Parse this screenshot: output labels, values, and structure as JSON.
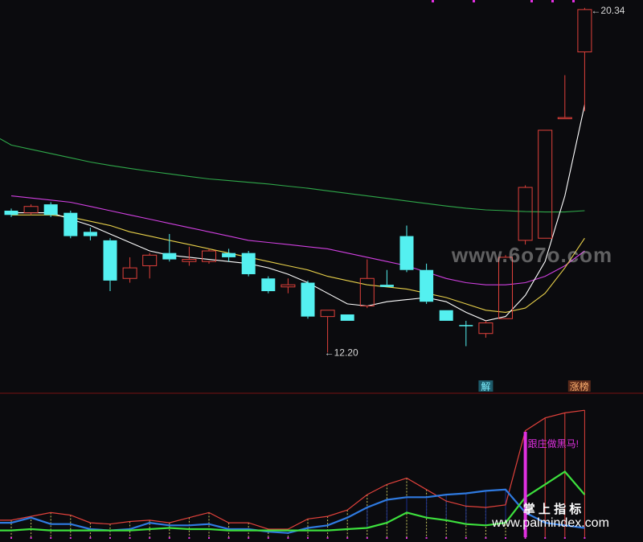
{
  "colors": {
    "background": "#0b0b0e",
    "up_candle": "#e0413b",
    "down_candle": "#54f0f0",
    "ma5": "#ffffff",
    "ma10": "#e8d04a",
    "ma20": "#d040e0",
    "ma60": "#2fa84a",
    "sub_red": "#e0413b",
    "sub_blue": "#2f7ae0",
    "sub_green": "#3de03d",
    "marker": "#e030e0",
    "divider": "#7a1212"
  },
  "labels": {
    "low_price": "12.20",
    "high_price": "20.34",
    "tag_jie": "解",
    "tag_zhangbang": "涨榜",
    "sub_signal": "跟庄做黑马!",
    "watermark_top": "www.6o7o.com",
    "watermark_brand": "掌 上 指 标",
    "watermark_url": "www.palmindex.com"
  },
  "chart_data": [
    {
      "type": "candlestick",
      "title": "",
      "ylim": [
        11.6,
        20.45
      ],
      "annotations": [
        {
          "text": "12.20",
          "at_index": 16,
          "value": 12.2
        },
        {
          "text": "20.34",
          "at_index": 29,
          "value": 20.34
        },
        {
          "text": "解",
          "at_index": 24
        },
        {
          "text": "涨榜",
          "at_index": 28
        }
      ],
      "candles": [
        {
          "o": 15.55,
          "c": 15.45,
          "h": 15.6,
          "l": 15.4
        },
        {
          "o": 15.5,
          "c": 15.65,
          "h": 15.7,
          "l": 15.45
        },
        {
          "o": 15.7,
          "c": 15.45,
          "h": 15.75,
          "l": 15.4
        },
        {
          "o": 15.5,
          "c": 14.95,
          "h": 15.55,
          "l": 14.9
        },
        {
          "o": 15.05,
          "c": 14.95,
          "h": 15.15,
          "l": 14.85
        },
        {
          "o": 14.85,
          "c": 13.9,
          "h": 14.9,
          "l": 13.65
        },
        {
          "o": 13.95,
          "c": 14.2,
          "h": 14.45,
          "l": 13.85
        },
        {
          "o": 14.25,
          "c": 14.5,
          "h": 14.55,
          "l": 13.95
        },
        {
          "o": 14.55,
          "c": 14.4,
          "h": 15.0,
          "l": 14.35
        },
        {
          "o": 14.35,
          "c": 14.4,
          "h": 14.7,
          "l": 14.25
        },
        {
          "o": 14.35,
          "c": 14.6,
          "h": 14.65,
          "l": 14.3
        },
        {
          "o": 14.55,
          "c": 14.45,
          "h": 14.65,
          "l": 14.35
        },
        {
          "o": 14.55,
          "c": 14.05,
          "h": 14.6,
          "l": 14.0
        },
        {
          "o": 13.95,
          "c": 13.65,
          "h": 14.0,
          "l": 13.6
        },
        {
          "o": 13.75,
          "c": 13.8,
          "h": 13.95,
          "l": 13.6
        },
        {
          "o": 13.85,
          "c": 13.05,
          "h": 13.9,
          "l": 13.0
        },
        {
          "o": 13.05,
          "c": 13.2,
          "h": 13.2,
          "l": 12.2
        },
        {
          "o": 13.1,
          "c": 12.95,
          "h": 13.1,
          "l": 12.95
        },
        {
          "o": 13.3,
          "c": 13.95,
          "h": 14.4,
          "l": 13.25
        },
        {
          "o": 13.8,
          "c": 13.75,
          "h": 14.15,
          "l": 13.75
        },
        {
          "o": 14.95,
          "c": 14.15,
          "h": 15.2,
          "l": 14.1
        },
        {
          "o": 14.15,
          "c": 13.4,
          "h": 14.3,
          "l": 13.35
        },
        {
          "o": 13.2,
          "c": 12.95,
          "h": 13.2,
          "l": 12.95
        },
        {
          "o": 12.85,
          "c": 12.85,
          "h": 12.95,
          "l": 12.35
        },
        {
          "o": 12.65,
          "c": 12.9,
          "h": 12.95,
          "l": 12.55
        },
        {
          "o": 13.0,
          "c": 14.45,
          "h": 14.5,
          "l": 13.0
        },
        {
          "o": 14.85,
          "c": 16.1,
          "h": 16.15,
          "l": 14.75
        },
        {
          "o": 14.9,
          "c": 17.45,
          "h": 17.45,
          "l": 14.9
        },
        {
          "o": 17.75,
          "c": 17.75,
          "h": 18.75,
          "l": 17.75
        },
        {
          "o": 19.3,
          "c": 20.3,
          "h": 20.34,
          "l": 17.9
        }
      ],
      "series": [
        {
          "values": [
            15.5,
            15.5,
            15.5,
            15.35,
            15.2,
            15.0,
            14.8,
            14.6,
            14.5,
            14.45,
            14.4,
            14.35,
            14.3,
            14.2,
            14.05,
            13.85,
            13.6,
            13.35,
            13.3,
            13.4,
            13.45,
            13.5,
            13.4,
            13.15,
            12.95,
            13.05,
            13.55,
            14.35,
            15.9,
            18.05
          ]
        },
        {
          "values": [
            15.45,
            15.45,
            15.45,
            15.4,
            15.3,
            15.2,
            15.05,
            14.95,
            14.85,
            14.75,
            14.65,
            14.55,
            14.45,
            14.35,
            14.25,
            14.15,
            14.0,
            13.9,
            13.8,
            13.75,
            13.7,
            13.6,
            13.5,
            13.35,
            13.2,
            13.15,
            13.25,
            13.6,
            14.2,
            14.9
          ]
        },
        {
          "values": [
            15.9,
            15.85,
            15.8,
            15.75,
            15.65,
            15.55,
            15.45,
            15.35,
            15.25,
            15.15,
            15.05,
            14.95,
            14.85,
            14.8,
            14.75,
            14.7,
            14.65,
            14.55,
            14.45,
            14.35,
            14.25,
            14.1,
            13.95,
            13.85,
            13.8,
            13.8,
            13.85,
            14.0,
            14.25,
            14.6
          ]
        },
        {
          "values": [
            17.1,
            17.0,
            16.9,
            16.8,
            16.7,
            16.62,
            16.55,
            16.48,
            16.42,
            16.36,
            16.3,
            16.26,
            16.22,
            16.18,
            16.13,
            16.08,
            16.02,
            15.96,
            15.9,
            15.84,
            15.78,
            15.72,
            15.66,
            15.61,
            15.57,
            15.55,
            15.53,
            15.52,
            15.52,
            15.55
          ]
        }
      ]
    },
    {
      "type": "line",
      "title": "",
      "ylim": [
        0,
        100
      ],
      "annotations": [
        {
          "text": "跟庄做黑马!",
          "at_index": 26
        }
      ],
      "series": [
        {
          "values": [
            12,
            15,
            18,
            16,
            10,
            9,
            11,
            12,
            10,
            14,
            18,
            10,
            10,
            5,
            5,
            13,
            15,
            20,
            32,
            40,
            45,
            36,
            27,
            23,
            22,
            24,
            82,
            92,
            96,
            98
          ]
        },
        {
          "values": [
            10,
            14,
            9,
            9,
            5,
            4,
            5,
            10,
            8,
            8,
            9,
            5,
            5,
            3,
            2,
            6,
            8,
            14,
            22,
            28,
            30,
            30,
            32,
            33,
            35,
            36,
            18,
            10,
            8,
            6
          ]
        },
        {
          "values": [
            4,
            5,
            4,
            4,
            4,
            4,
            4,
            5,
            6,
            5,
            5,
            4,
            4,
            4,
            4,
            4,
            4,
            5,
            6,
            10,
            18,
            14,
            12,
            9,
            8,
            10,
            30,
            40,
            50,
            32
          ]
        }
      ]
    }
  ]
}
